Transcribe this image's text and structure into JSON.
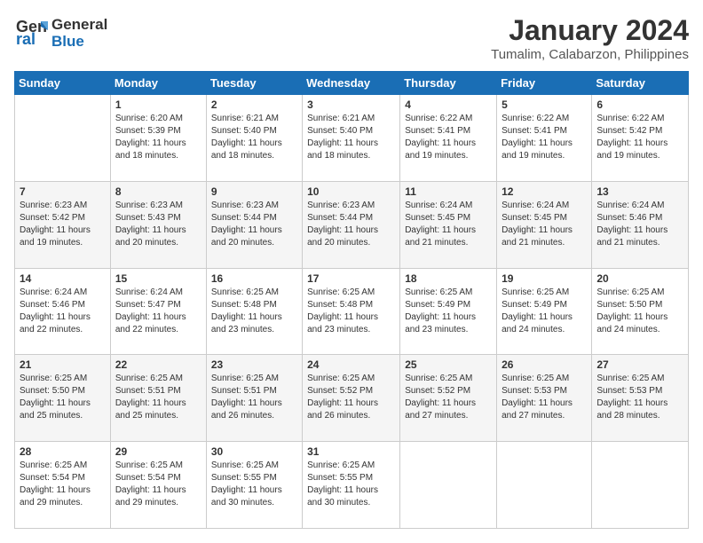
{
  "header": {
    "logo_line1": "General",
    "logo_line2": "Blue",
    "title": "January 2024",
    "subtitle": "Tumalim, Calabarzon, Philippines"
  },
  "columns": [
    "Sunday",
    "Monday",
    "Tuesday",
    "Wednesday",
    "Thursday",
    "Friday",
    "Saturday"
  ],
  "weeks": [
    [
      {
        "day": "",
        "detail": ""
      },
      {
        "day": "1",
        "detail": "Sunrise: 6:20 AM\nSunset: 5:39 PM\nDaylight: 11 hours\nand 18 minutes."
      },
      {
        "day": "2",
        "detail": "Sunrise: 6:21 AM\nSunset: 5:40 PM\nDaylight: 11 hours\nand 18 minutes."
      },
      {
        "day": "3",
        "detail": "Sunrise: 6:21 AM\nSunset: 5:40 PM\nDaylight: 11 hours\nand 18 minutes."
      },
      {
        "day": "4",
        "detail": "Sunrise: 6:22 AM\nSunset: 5:41 PM\nDaylight: 11 hours\nand 19 minutes."
      },
      {
        "day": "5",
        "detail": "Sunrise: 6:22 AM\nSunset: 5:41 PM\nDaylight: 11 hours\nand 19 minutes."
      },
      {
        "day": "6",
        "detail": "Sunrise: 6:22 AM\nSunset: 5:42 PM\nDaylight: 11 hours\nand 19 minutes."
      }
    ],
    [
      {
        "day": "7",
        "detail": "Sunrise: 6:23 AM\nSunset: 5:42 PM\nDaylight: 11 hours\nand 19 minutes."
      },
      {
        "day": "8",
        "detail": "Sunrise: 6:23 AM\nSunset: 5:43 PM\nDaylight: 11 hours\nand 20 minutes."
      },
      {
        "day": "9",
        "detail": "Sunrise: 6:23 AM\nSunset: 5:44 PM\nDaylight: 11 hours\nand 20 minutes."
      },
      {
        "day": "10",
        "detail": "Sunrise: 6:23 AM\nSunset: 5:44 PM\nDaylight: 11 hours\nand 20 minutes."
      },
      {
        "day": "11",
        "detail": "Sunrise: 6:24 AM\nSunset: 5:45 PM\nDaylight: 11 hours\nand 21 minutes."
      },
      {
        "day": "12",
        "detail": "Sunrise: 6:24 AM\nSunset: 5:45 PM\nDaylight: 11 hours\nand 21 minutes."
      },
      {
        "day": "13",
        "detail": "Sunrise: 6:24 AM\nSunset: 5:46 PM\nDaylight: 11 hours\nand 21 minutes."
      }
    ],
    [
      {
        "day": "14",
        "detail": "Sunrise: 6:24 AM\nSunset: 5:46 PM\nDaylight: 11 hours\nand 22 minutes."
      },
      {
        "day": "15",
        "detail": "Sunrise: 6:24 AM\nSunset: 5:47 PM\nDaylight: 11 hours\nand 22 minutes."
      },
      {
        "day": "16",
        "detail": "Sunrise: 6:25 AM\nSunset: 5:48 PM\nDaylight: 11 hours\nand 23 minutes."
      },
      {
        "day": "17",
        "detail": "Sunrise: 6:25 AM\nSunset: 5:48 PM\nDaylight: 11 hours\nand 23 minutes."
      },
      {
        "day": "18",
        "detail": "Sunrise: 6:25 AM\nSunset: 5:49 PM\nDaylight: 11 hours\nand 23 minutes."
      },
      {
        "day": "19",
        "detail": "Sunrise: 6:25 AM\nSunset: 5:49 PM\nDaylight: 11 hours\nand 24 minutes."
      },
      {
        "day": "20",
        "detail": "Sunrise: 6:25 AM\nSunset: 5:50 PM\nDaylight: 11 hours\nand 24 minutes."
      }
    ],
    [
      {
        "day": "21",
        "detail": "Sunrise: 6:25 AM\nSunset: 5:50 PM\nDaylight: 11 hours\nand 25 minutes."
      },
      {
        "day": "22",
        "detail": "Sunrise: 6:25 AM\nSunset: 5:51 PM\nDaylight: 11 hours\nand 25 minutes."
      },
      {
        "day": "23",
        "detail": "Sunrise: 6:25 AM\nSunset: 5:51 PM\nDaylight: 11 hours\nand 26 minutes."
      },
      {
        "day": "24",
        "detail": "Sunrise: 6:25 AM\nSunset: 5:52 PM\nDaylight: 11 hours\nand 26 minutes."
      },
      {
        "day": "25",
        "detail": "Sunrise: 6:25 AM\nSunset: 5:52 PM\nDaylight: 11 hours\nand 27 minutes."
      },
      {
        "day": "26",
        "detail": "Sunrise: 6:25 AM\nSunset: 5:53 PM\nDaylight: 11 hours\nand 27 minutes."
      },
      {
        "day": "27",
        "detail": "Sunrise: 6:25 AM\nSunset: 5:53 PM\nDaylight: 11 hours\nand 28 minutes."
      }
    ],
    [
      {
        "day": "28",
        "detail": "Sunrise: 6:25 AM\nSunset: 5:54 PM\nDaylight: 11 hours\nand 29 minutes."
      },
      {
        "day": "29",
        "detail": "Sunrise: 6:25 AM\nSunset: 5:54 PM\nDaylight: 11 hours\nand 29 minutes."
      },
      {
        "day": "30",
        "detail": "Sunrise: 6:25 AM\nSunset: 5:55 PM\nDaylight: 11 hours\nand 30 minutes."
      },
      {
        "day": "31",
        "detail": "Sunrise: 6:25 AM\nSunset: 5:55 PM\nDaylight: 11 hours\nand 30 minutes."
      },
      {
        "day": "",
        "detail": ""
      },
      {
        "day": "",
        "detail": ""
      },
      {
        "day": "",
        "detail": ""
      }
    ]
  ]
}
